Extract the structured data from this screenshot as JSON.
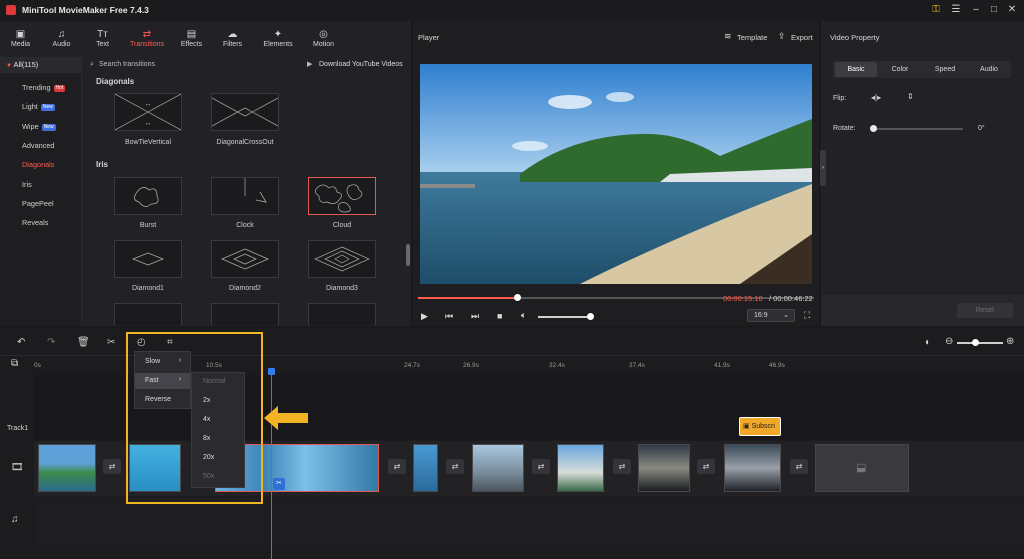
{
  "app": {
    "title": "MiniTool MovieMaker Free 7.4.3"
  },
  "toolbar": {
    "items": [
      {
        "label": "Media",
        "icon": "▣"
      },
      {
        "label": "Audio",
        "icon": "♫"
      },
      {
        "label": "Text",
        "icon": "Tт"
      },
      {
        "label": "Transitions",
        "icon": "⇄"
      },
      {
        "label": "Effects",
        "icon": "▤"
      },
      {
        "label": "Filters",
        "icon": "☁"
      },
      {
        "label": "Elements",
        "icon": "✦"
      },
      {
        "label": "Motion",
        "icon": "◎"
      }
    ]
  },
  "categories": {
    "all": "All(115)",
    "items": [
      {
        "label": "Trending",
        "badge": "Hot"
      },
      {
        "label": "Light",
        "badge": "New"
      },
      {
        "label": "Wipe",
        "badge": "New"
      },
      {
        "label": "Advanced",
        "badge": ""
      },
      {
        "label": "Diagonals",
        "badge": ""
      },
      {
        "label": "Iris",
        "badge": ""
      },
      {
        "label": "PagePeel",
        "badge": ""
      },
      {
        "label": "Reveals",
        "badge": ""
      }
    ]
  },
  "search": {
    "placeholder": "Search transitions",
    "download_label": "Download YouTube Videos"
  },
  "sections": {
    "diagonals": "Diagonals",
    "iris": "Iris"
  },
  "transitions": {
    "bowtie": "BowTieVertical",
    "diagcross": "DiagonalCrossOut",
    "burst": "Burst",
    "clock": "Clock",
    "cloud": "Cloud",
    "diamond1": "Diamond1",
    "diamond2": "Diamond2",
    "diamond3": "Diamond3"
  },
  "player": {
    "title": "Player",
    "template_label": "Template",
    "export_label": "Export",
    "current_time": "00:00:15.10",
    "total_time": "/ 00:00:46:22",
    "aspect": "16:9",
    "progress": 0.25
  },
  "property": {
    "title": "Video Property",
    "tabs": [
      "Basic",
      "Color",
      "Speed",
      "Audio"
    ],
    "flip_label": "Flip:",
    "rotate_label": "Rotate:",
    "rotate_value": "0°",
    "reset_label": "Reset"
  },
  "timeline": {
    "ruler": [
      "0s",
      "10.5s",
      "24.7s",
      "26.9s",
      "32.4s",
      "37.4s",
      "41.9s",
      "46.9s"
    ],
    "track_label": "Track1",
    "subtitle_label": "Subscri"
  },
  "speed_menu": {
    "items": [
      "Slow",
      "Fast",
      "Reverse"
    ],
    "sub_items": [
      "Normal",
      "2x",
      "4x",
      "8x",
      "20x",
      "50x"
    ]
  },
  "colors": {
    "accent": "#ff5b4f",
    "highlight_box": "#f2b324"
  }
}
